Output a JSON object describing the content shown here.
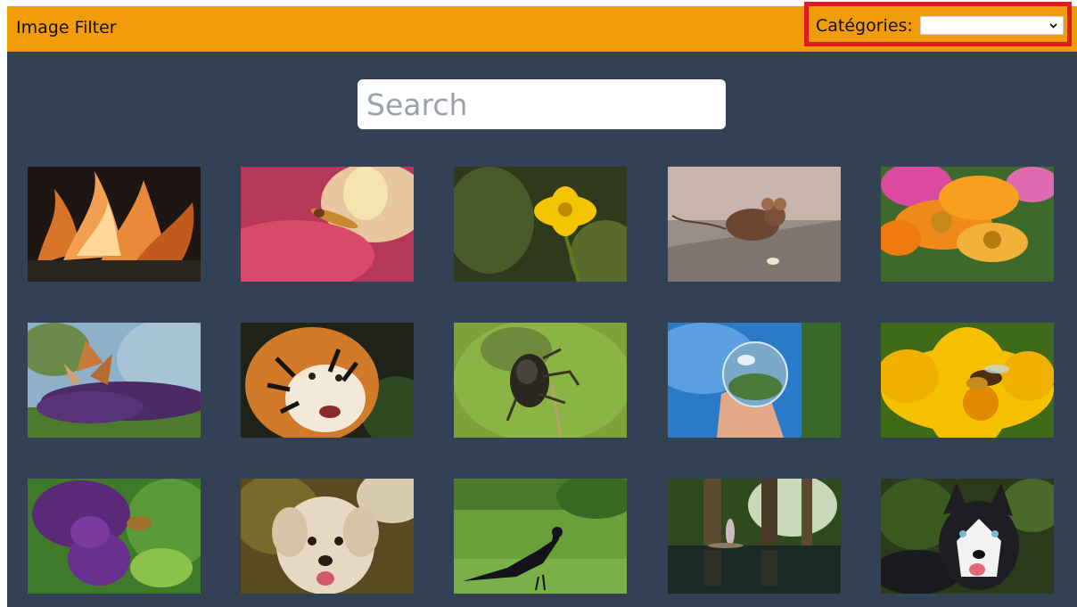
{
  "navbar": {
    "title": "Image Filter",
    "categories_label": "Catégories:",
    "categories_selected": "",
    "colors": {
      "bar": "#f39c0b",
      "highlight": "#e11b22"
    }
  },
  "search": {
    "placeholder": "Search",
    "value": ""
  },
  "page": {
    "background": "#334155"
  },
  "gallery": [
    {
      "subject": "flames",
      "icon": "flame-photo"
    },
    {
      "subject": "hoverfly on pink flower",
      "icon": "hoverfly-photo"
    },
    {
      "subject": "yellow flower",
      "icon": "yellow-flower-photo"
    },
    {
      "subject": "mouse",
      "icon": "mouse-photo"
    },
    {
      "subject": "orange flowers",
      "icon": "orange-flowers-photo"
    },
    {
      "subject": "butterfly on lilac",
      "icon": "butterfly-photo"
    },
    {
      "subject": "tiger",
      "icon": "tiger-photo"
    },
    {
      "subject": "beetle",
      "icon": "beetle-photo"
    },
    {
      "subject": "glass ball in hand",
      "icon": "glass-ball-photo"
    },
    {
      "subject": "bee on yellow flower",
      "icon": "bee-photo"
    },
    {
      "subject": "bee on purple lilac",
      "icon": "lilac-bee-photo"
    },
    {
      "subject": "poodle dog",
      "icon": "poodle-photo"
    },
    {
      "subject": "crow on grass",
      "icon": "crow-photo"
    },
    {
      "subject": "forest stream",
      "icon": "forest-stream-photo"
    },
    {
      "subject": "husky dog",
      "icon": "husky-photo"
    }
  ]
}
